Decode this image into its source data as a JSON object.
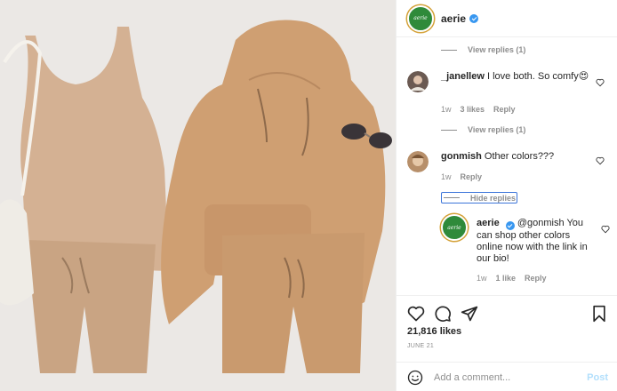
{
  "post": {
    "username": "aerie",
    "avatar_text": "aerie",
    "verified_icon": "verified-badge-icon"
  },
  "comments": {
    "view_replies_1": "View replies (1)",
    "comment1": {
      "username": "_janellew",
      "text": "I love both. So comfy😍",
      "time": "1w",
      "likes": "3 likes",
      "reply": "Reply"
    },
    "view_replies_2": "View replies (1)",
    "comment2": {
      "username": "gonmish",
      "text": "Other colors???",
      "time": "1w",
      "reply": "Reply"
    },
    "hide_replies": "Hide replies",
    "reply": {
      "username": "aerie",
      "mention": "@gonmish",
      "text": "You can shop other colors online now with the link in our bio!",
      "time": "1w",
      "likes": "1 like",
      "reply": "Reply"
    }
  },
  "actions": {
    "likes_count": "21,816 likes",
    "date": "JUNE 21"
  },
  "add_comment": {
    "placeholder": "Add a comment...",
    "post_label": "Post"
  },
  "colors": {
    "brand_green": "#2f8a3a",
    "verified_blue": "#3897f0",
    "muted": "#8e8e8e",
    "post_disabled": "#b2dffc"
  }
}
